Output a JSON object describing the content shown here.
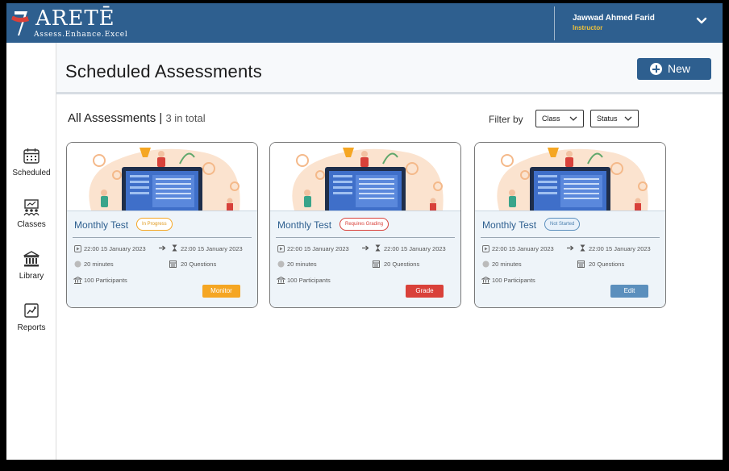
{
  "brand": {
    "title": "ARETĒ",
    "tagline": "Assess.Enhance.Excel"
  },
  "user": {
    "name": "Jawwad Ahmed Farid",
    "role": "Instructor"
  },
  "sidebar": {
    "items": [
      {
        "label": "Scheduled",
        "icon": "calendar-icon"
      },
      {
        "label": "Classes",
        "icon": "classroom-icon"
      },
      {
        "label": "Library",
        "icon": "library-icon"
      },
      {
        "label": "Reports",
        "icon": "report-chart-icon"
      }
    ]
  },
  "page": {
    "title": "Scheduled Assessments",
    "new_label": "New"
  },
  "listing": {
    "heading": "All Assessments",
    "separator": "|",
    "count_text": "3 in total",
    "filter_label": "Filter by",
    "filters": [
      {
        "label": "Class"
      },
      {
        "label": "Status"
      }
    ]
  },
  "cards": [
    {
      "title": "Monthly Test",
      "status": "In Progress",
      "start": "22:00 15 January 2023",
      "end": "22:00 15 January 2023",
      "duration": "20 minutes",
      "questions": "20 Questions",
      "participants": "100 Participants",
      "action": "Monitor"
    },
    {
      "title": "Monthly Test",
      "status": "Requires Grading",
      "start": "22:00 15 January 2023",
      "end": "22:00 15 January 2023",
      "duration": "20 minutes",
      "questions": "20 Questions",
      "participants": "100 Participants",
      "action": "Grade"
    },
    {
      "title": "Monthly Test",
      "status": "Not Started",
      "start": "22:00 15 January 2023",
      "end": "22:00 15 January 2023",
      "duration": "20 minutes",
      "questions": "20 Questions",
      "participants": "100 Participants",
      "action": "Edit"
    }
  ],
  "colors": {
    "header_bg": "#2e5f8f",
    "accent": "#2e5f8f",
    "role_text": "#f0c23a",
    "status_in_progress": "#f5a623",
    "status_requires_grading": "#d9413a",
    "status_not_started": "#5b8fbd",
    "btn_monitor": "#f5a623",
    "btn_grade": "#d9413a",
    "btn_edit": "#5b8fbd"
  }
}
